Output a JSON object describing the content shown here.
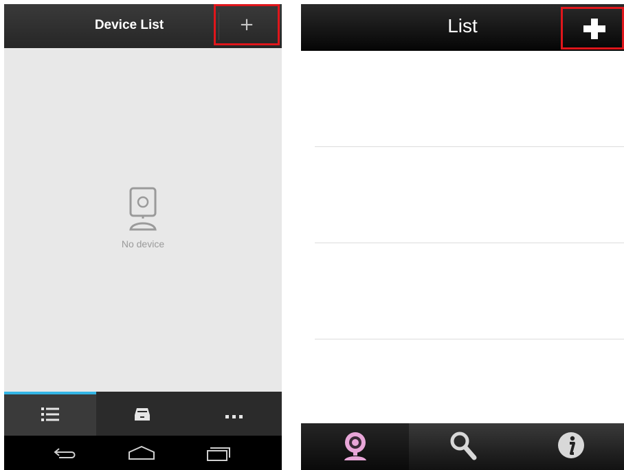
{
  "left_app": {
    "header": {
      "title": "Device List",
      "add_icon": "plus-icon",
      "add_label": "+"
    },
    "empty_state": {
      "icon": "camera-icon",
      "label": "No device"
    },
    "tabs": [
      {
        "icon": "list-icon",
        "active": true
      },
      {
        "icon": "tray-icon",
        "active": false
      },
      {
        "icon": "more-icon",
        "active": false
      }
    ],
    "navbar": [
      {
        "icon": "back-icon"
      },
      {
        "icon": "home-icon"
      },
      {
        "icon": "recent-apps-icon"
      }
    ],
    "accent_color": "#33b5e5",
    "highlight_color": "#e0161b"
  },
  "right_app": {
    "header": {
      "title": "List",
      "add_icon": "plus-icon"
    },
    "list_rows": 4,
    "tabs": [
      {
        "icon": "webcam-icon",
        "active": true
      },
      {
        "icon": "search-icon",
        "active": false
      },
      {
        "icon": "info-icon",
        "active": false
      }
    ],
    "camera_tab_color": "#e8a6d8",
    "highlight_color": "#e0161b"
  }
}
